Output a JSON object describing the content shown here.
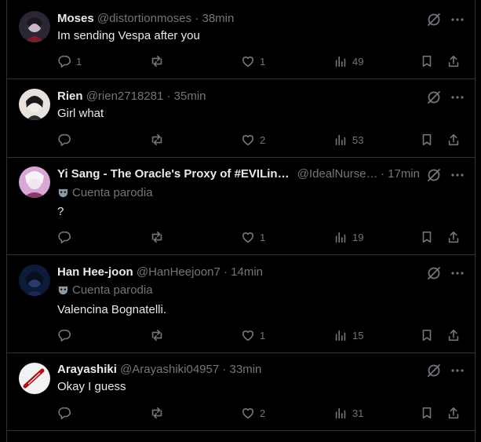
{
  "tweets": [
    {
      "name": "Moses",
      "handle": "@distortionmoses",
      "dot": "·",
      "time": "38min",
      "parody": "",
      "text": "Im sending Vespa after you",
      "replies": "1",
      "retweets": "",
      "likes": "1",
      "views": "49",
      "avatar_colors": [
        "#2b2633",
        "#c9b7c9",
        "#7a1d2a"
      ]
    },
    {
      "name": "Rien",
      "handle": "@rien2718281",
      "dot": "·",
      "time": "35min",
      "parody": "",
      "text": "Girl what",
      "replies": "",
      "retweets": "",
      "likes": "2",
      "views": "53",
      "avatar_colors": [
        "#1a1a1f",
        "#e8e2dc",
        "#2c2c33"
      ]
    },
    {
      "name": "Yi Sang - The Oracle's Proxy of #EVILin…",
      "handle": "@IdealNurse…",
      "dot": "·",
      "time": "17min",
      "parody": "Cuenta parodia",
      "text": "?",
      "replies": "",
      "retweets": "",
      "likes": "1",
      "views": "19",
      "avatar_colors": [
        "#d9a6d6",
        "#f2e6f0",
        "#8b3a66"
      ]
    },
    {
      "name": "Han Hee-joon",
      "handle": "@HanHeejoon7",
      "dot": "·",
      "time": "14min",
      "parody": "Cuenta parodia",
      "text": "Valencina Bognatelli.",
      "replies": "",
      "retweets": "",
      "likes": "1",
      "views": "15",
      "avatar_colors": [
        "#0d1a3a",
        "#2a3b6b",
        "#0a0f1f"
      ]
    },
    {
      "name": "Arayashiki",
      "handle": "@Arayashiki04957",
      "dot": "·",
      "time": "33min",
      "parody": "",
      "text": "Okay I guess",
      "replies": "",
      "retweets": "",
      "likes": "2",
      "views": "31",
      "avatar_colors": [
        "#f2f2f2",
        "#b01010",
        "#d9d9d9"
      ]
    }
  ]
}
